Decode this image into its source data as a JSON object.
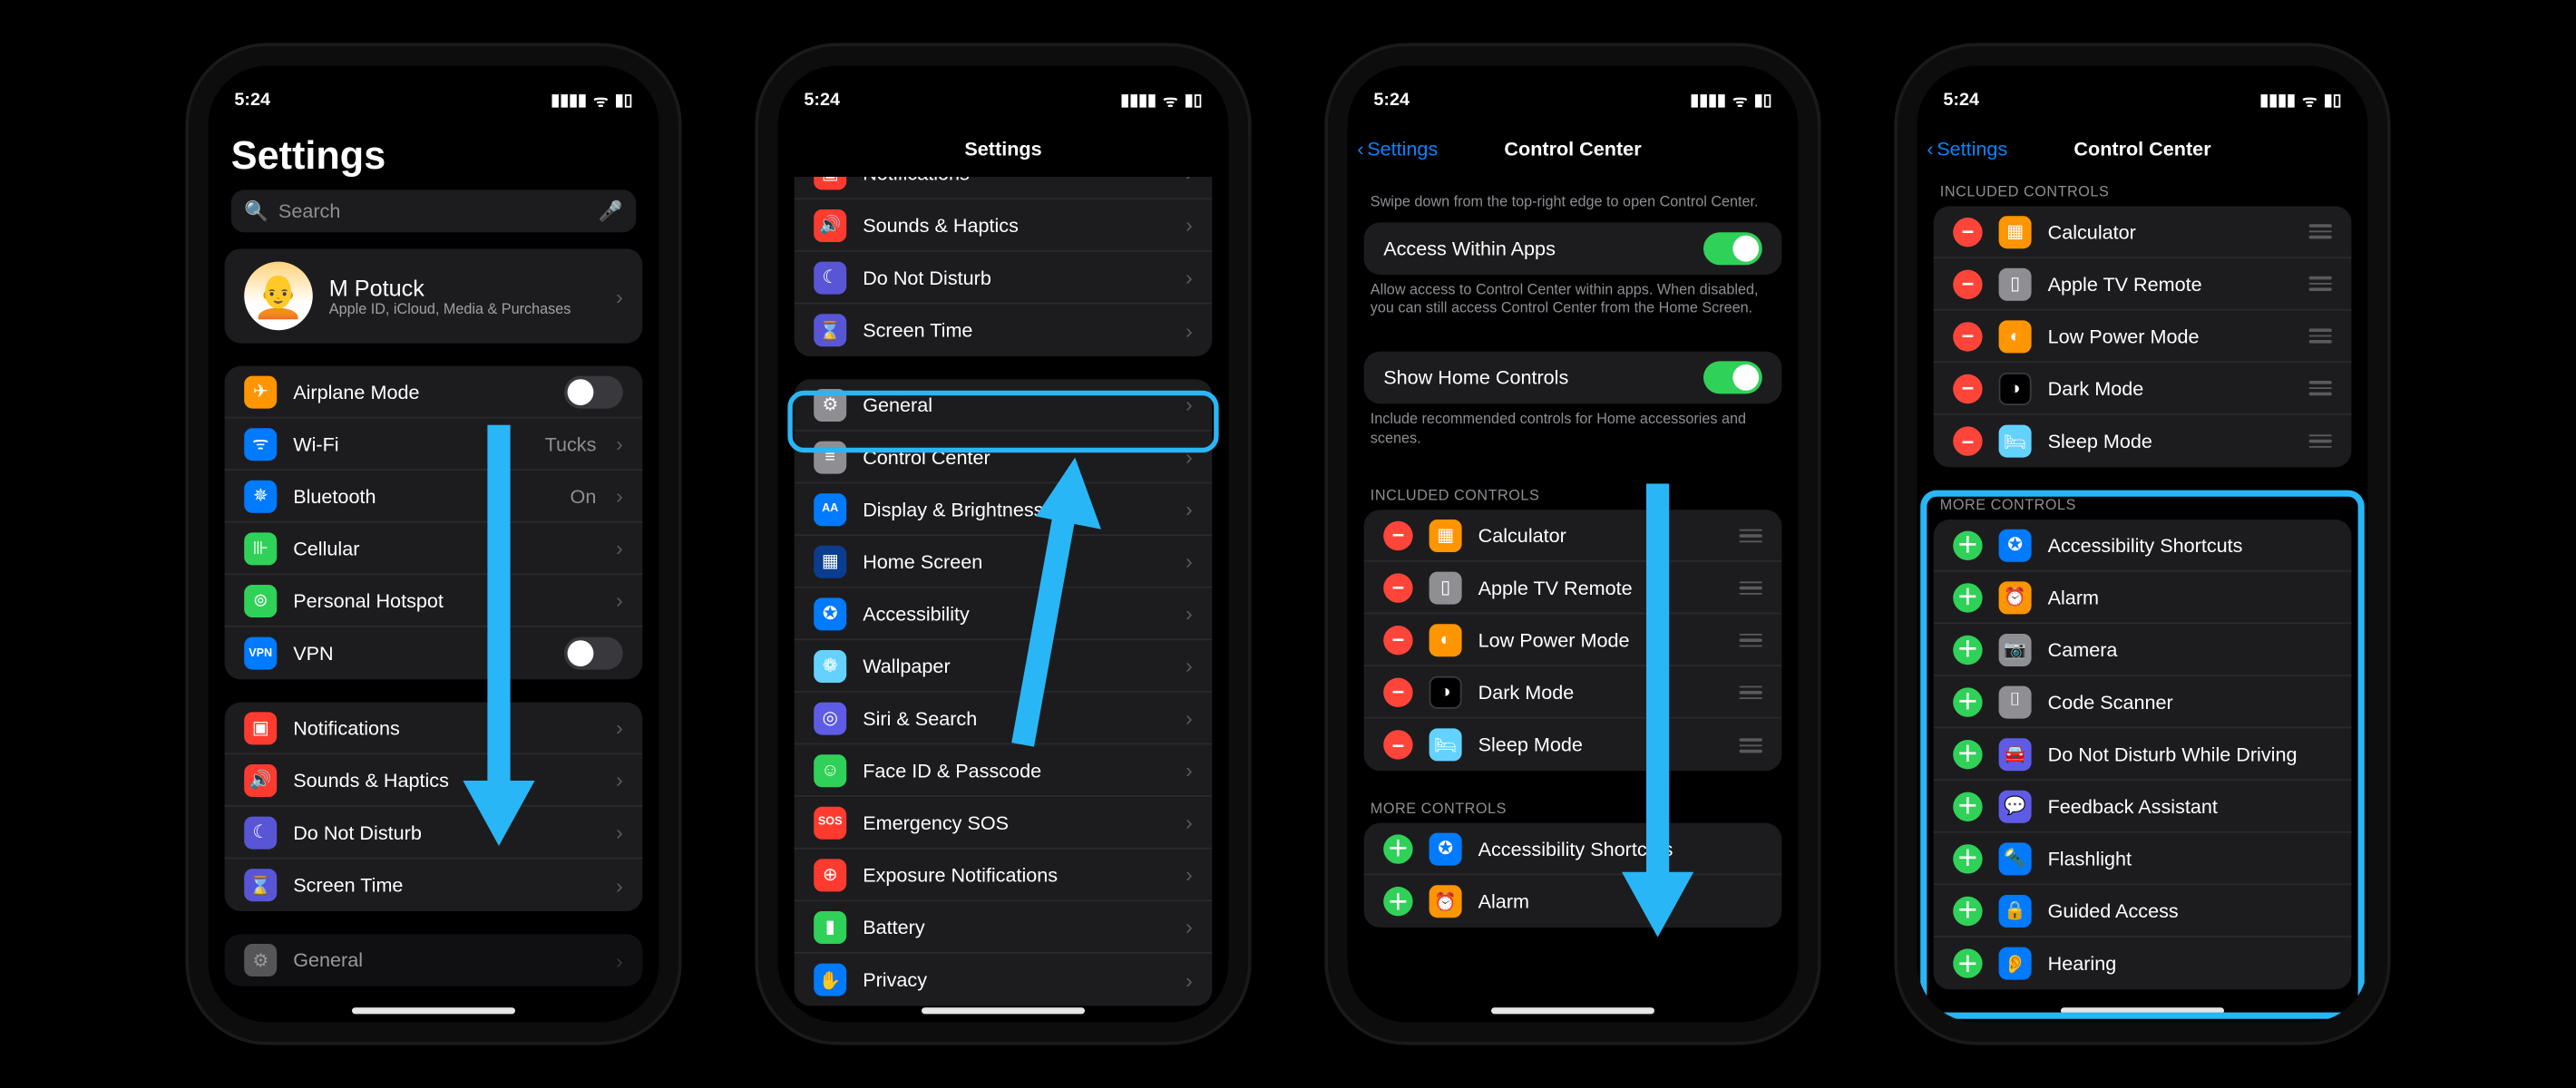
{
  "status": {
    "time": "5:24",
    "loc_arrow": "➤"
  },
  "phone1": {
    "title": "Settings",
    "search_placeholder": "Search",
    "profile": {
      "name": "M Potuck",
      "sub": "Apple ID, iCloud, Media & Purchases"
    },
    "g1": [
      {
        "icon": "orange",
        "glyph": "✈︎",
        "label": "Airplane Mode",
        "acc": "toggle-off"
      },
      {
        "icon": "blue",
        "glyph": "ᯤ",
        "label": "Wi-Fi",
        "acc": "detail",
        "detail": "Tucks"
      },
      {
        "icon": "blue",
        "glyph": "✵",
        "label": "Bluetooth",
        "acc": "detail",
        "detail": "On"
      },
      {
        "icon": "green",
        "glyph": "⊪",
        "label": "Cellular",
        "acc": "chev"
      },
      {
        "icon": "green",
        "glyph": "⊚",
        "label": "Personal Hotspot",
        "acc": "chev"
      },
      {
        "icon": "blue",
        "glyph": "VPN",
        "label": "VPN",
        "acc": "toggle-off",
        "sm": true
      }
    ],
    "g2": [
      {
        "icon": "red",
        "glyph": "▣",
        "label": "Notifications",
        "acc": "chev"
      },
      {
        "icon": "red",
        "glyph": "🔊",
        "label": "Sounds & Haptics",
        "acc": "chev"
      },
      {
        "icon": "purple",
        "glyph": "☾",
        "label": "Do Not Disturb",
        "acc": "chev"
      },
      {
        "icon": "purple",
        "glyph": "⌛",
        "label": "Screen Time",
        "acc": "chev"
      }
    ],
    "g3": [
      {
        "icon": "grey",
        "glyph": "⚙︎",
        "label": "General",
        "acc": "chev"
      }
    ]
  },
  "phone2": {
    "nav_title": "Settings",
    "g1": [
      {
        "icon": "red",
        "glyph": "▣",
        "label": "Notifications",
        "acc": "chev"
      },
      {
        "icon": "red",
        "glyph": "🔊",
        "label": "Sounds & Haptics",
        "acc": "chev"
      },
      {
        "icon": "purple",
        "glyph": "☾",
        "label": "Do Not Disturb",
        "acc": "chev"
      },
      {
        "icon": "purple",
        "glyph": "⌛",
        "label": "Screen Time",
        "acc": "chev"
      }
    ],
    "g2": [
      {
        "icon": "grey",
        "glyph": "⚙︎",
        "label": "General",
        "acc": "chev"
      },
      {
        "icon": "grey",
        "glyph": "≡",
        "label": "Control Center",
        "acc": "chev",
        "hl": true
      },
      {
        "icon": "blue",
        "glyph": "AA",
        "label": "Display & Brightness",
        "acc": "chev",
        "sm": true
      },
      {
        "icon": "dkblue",
        "glyph": "▦",
        "label": "Home Screen",
        "acc": "chev"
      },
      {
        "icon": "blue",
        "glyph": "✪",
        "label": "Accessibility",
        "acc": "chev"
      },
      {
        "icon": "teal",
        "glyph": "❁",
        "label": "Wallpaper",
        "acc": "chev"
      },
      {
        "icon": "indigo",
        "glyph": "◎",
        "label": "Siri & Search",
        "acc": "chev"
      },
      {
        "icon": "green",
        "glyph": "☺︎",
        "label": "Face ID & Passcode",
        "acc": "chev"
      },
      {
        "icon": "sos",
        "glyph": "SOS",
        "label": "Emergency SOS",
        "acc": "chev"
      },
      {
        "icon": "red",
        "glyph": "⊕",
        "label": "Exposure Notifications",
        "acc": "chev"
      },
      {
        "icon": "green",
        "glyph": "▮",
        "label": "Battery",
        "acc": "chev"
      },
      {
        "icon": "blue",
        "glyph": "✋",
        "label": "Privacy",
        "acc": "chev"
      }
    ]
  },
  "phone3": {
    "back": "Settings",
    "title": "Control Center",
    "desc": "Swipe down from the top-right edge to open Control Center.",
    "access_label": "Access Within Apps",
    "access_footer": "Allow access to Control Center within apps. When disabled, you can still access Control Center from the Home Screen.",
    "home_label": "Show Home Controls",
    "home_footer": "Include recommended controls for Home accessories and scenes.",
    "included_header": "Included Controls",
    "included": [
      {
        "icon": "orange",
        "glyph": "▦",
        "label": "Calculator"
      },
      {
        "icon": "grey",
        "glyph": "▯",
        "label": "Apple TV Remote"
      },
      {
        "icon": "orange",
        "glyph": "◐",
        "label": "Low Power Mode"
      },
      {
        "icon": "black",
        "glyph": "◑",
        "label": "Dark Mode"
      },
      {
        "icon": "teal",
        "glyph": "🛏",
        "label": "Sleep Mode"
      }
    ],
    "more_header": "More Controls",
    "more": [
      {
        "icon": "blue",
        "glyph": "✪",
        "label": "Accessibility Shortcuts"
      },
      {
        "icon": "orange",
        "glyph": "⏰",
        "label": "Alarm"
      }
    ]
  },
  "phone4": {
    "back": "Settings",
    "title": "Control Center",
    "included_header": "Included Controls",
    "included": [
      {
        "icon": "orange",
        "glyph": "▦",
        "label": "Calculator"
      },
      {
        "icon": "grey",
        "glyph": "▯",
        "label": "Apple TV Remote"
      },
      {
        "icon": "orange",
        "glyph": "◐",
        "label": "Low Power Mode"
      },
      {
        "icon": "black",
        "glyph": "◑",
        "label": "Dark Mode"
      },
      {
        "icon": "teal",
        "glyph": "🛏",
        "label": "Sleep Mode"
      }
    ],
    "more_header": "More Controls",
    "more": [
      {
        "icon": "blue",
        "glyph": "✪",
        "label": "Accessibility Shortcuts"
      },
      {
        "icon": "orange",
        "glyph": "⏰",
        "label": "Alarm"
      },
      {
        "icon": "grey",
        "glyph": "📷",
        "label": "Camera"
      },
      {
        "icon": "grey",
        "glyph": "⌷",
        "label": "Code Scanner"
      },
      {
        "icon": "indigo",
        "glyph": "🚘",
        "label": "Do Not Disturb While Driving"
      },
      {
        "icon": "indigo",
        "glyph": "💬",
        "label": "Feedback Assistant"
      },
      {
        "icon": "blue",
        "glyph": "🔦",
        "label": "Flashlight"
      },
      {
        "icon": "blue",
        "glyph": "🔒",
        "label": "Guided Access"
      },
      {
        "icon": "blue",
        "glyph": "👂",
        "label": "Hearing"
      }
    ]
  }
}
